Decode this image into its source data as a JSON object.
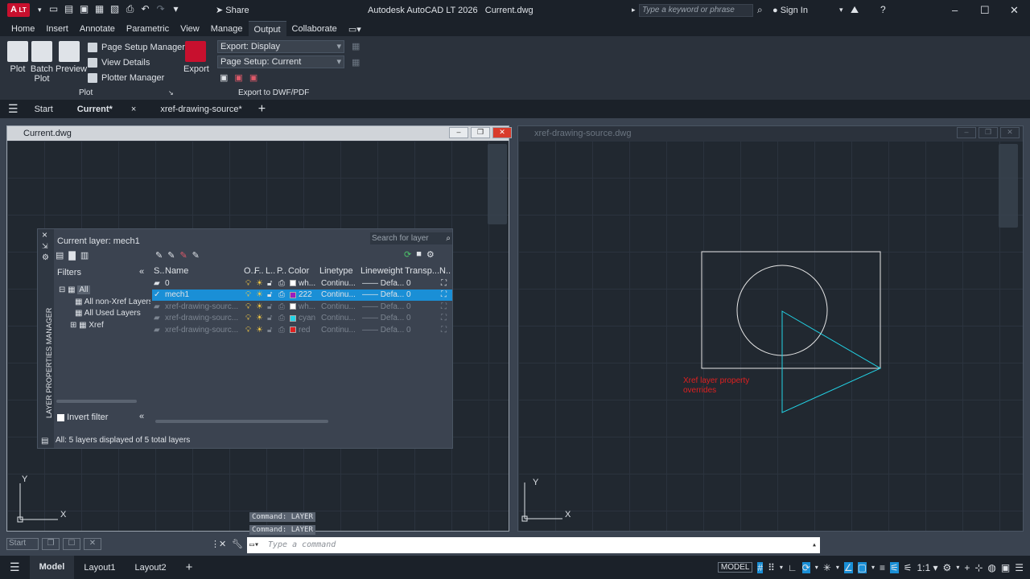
{
  "app": {
    "title": "Autodesk AutoCAD LT 2026",
    "file": "Current.dwg",
    "logo": "A",
    "logo_sub": "LT",
    "share": "Share",
    "search_placeholder": "Type a keyword or phrase",
    "sign_in": "Sign In"
  },
  "menu_tabs": [
    "Home",
    "Insert",
    "Annotate",
    "Parametric",
    "View",
    "Manage",
    "Output",
    "Collaborate"
  ],
  "active_tab": "Output",
  "ribbon": {
    "plot": "Plot",
    "batch_plot": "Batch Plot",
    "preview": "Preview",
    "page_setup_manager": "Page Setup Manager",
    "view_details": "View Details",
    "plotter_manager": "Plotter Manager",
    "plot_panel": "Plot",
    "export": "Export",
    "export_select": "Export: Display",
    "page_setup_select": "Page Setup: Current",
    "export_panel": "Export to DWF/PDF"
  },
  "file_tabs": {
    "start": "Start",
    "current": "Current*",
    "xref": "xref-drawing-source*"
  },
  "viewports": {
    "left_title": "Current.dwg",
    "right_title": "xref-drawing-source.dwg",
    "annotation": "Xref layer property overrides"
  },
  "layer_manager": {
    "side_title": "LAYER PROPERTIES MANAGER",
    "current_layer": "Current layer: mech1",
    "search_placeholder": "Search for layer",
    "filters_label": "Filters",
    "filter_tree": [
      "All",
      "All non-Xref Layers",
      "All Used Layers",
      "Xref"
    ],
    "invert_filter": "Invert filter",
    "columns": [
      "S..",
      "Name",
      "O..",
      "F..",
      "L..",
      "P..",
      "Color",
      "Linetype",
      "Lineweight",
      "Transp...",
      "N.."
    ],
    "layers": [
      {
        "name": "0",
        "color_name": "wh...",
        "color": "#ffffff",
        "linetype": "Continu...",
        "lineweight": "Defa...",
        "transp": "0",
        "selected": false,
        "xref": false
      },
      {
        "name": "mech1",
        "color_name": "222",
        "color": "#9b1bbf",
        "linetype": "Continu...",
        "lineweight": "Defa...",
        "transp": "0",
        "selected": true,
        "xref": false
      },
      {
        "name": "xref-drawing-sourc...",
        "color_name": "wh...",
        "color": "#ffffff",
        "linetype": "Continu...",
        "lineweight": "Defa...",
        "transp": "0",
        "selected": false,
        "xref": true
      },
      {
        "name": "xref-drawing-sourc...",
        "color_name": "cyan",
        "color": "#22d3e6",
        "linetype": "Continu...",
        "lineweight": "Defa...",
        "transp": "0",
        "selected": false,
        "xref": true
      },
      {
        "name": "xref-drawing-sourc...",
        "color_name": "red",
        "color": "#e02020",
        "linetype": "Continu...",
        "lineweight": "Defa...",
        "transp": "0",
        "selected": false,
        "xref": true
      }
    ],
    "status": "All: 5 layers displayed of 5 total layers"
  },
  "command": {
    "history": [
      "Command: LAYER",
      "Command: LAYER"
    ],
    "placeholder": "Type a command"
  },
  "status_bar": {
    "model": "Model",
    "layout1": "Layout1",
    "layout2": "Layout2",
    "model_label": "MODEL",
    "scale": "1:1"
  },
  "colors": {
    "accent": "#1a8fd6",
    "cyan_geom": "#22d3e6",
    "red_text": "#e02020"
  }
}
